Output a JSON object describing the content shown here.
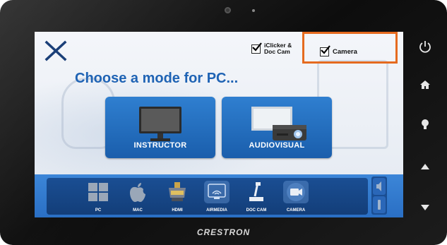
{
  "device": {
    "brand": "CRESTRON"
  },
  "screen": {
    "close_icon": "close-x-icon",
    "checkboxes": [
      {
        "label": "iClicker & Doc Cam",
        "checked": true
      },
      {
        "label": "Camera",
        "checked": true
      }
    ],
    "title": "Choose a mode for PC...",
    "modes": [
      {
        "label": "INSTRUCTOR",
        "icon": "monitor-icon"
      },
      {
        "label": "AUDIOVISUAL",
        "icon": "projector-icon"
      }
    ],
    "sources": [
      {
        "label": "PC",
        "icon": "windows-icon",
        "selected": false
      },
      {
        "label": "MAC",
        "icon": "apple-icon",
        "selected": false
      },
      {
        "label": "HDMI",
        "icon": "hdmi-icon",
        "selected": false
      },
      {
        "label": "AIRMEDIA",
        "icon": "airmedia-icon",
        "selected": true
      },
      {
        "label": "DOC CAM",
        "icon": "doc-cam-icon",
        "selected": false
      },
      {
        "label": "CAMERA",
        "icon": "video-camera-icon",
        "selected": true
      }
    ],
    "volume": {
      "up_icon": "volume-up-icon",
      "down_icon": "volume-down-icon"
    }
  },
  "side_buttons": [
    "power-icon",
    "home-icon",
    "lightbulb-icon",
    "arrow-up-icon",
    "arrow-down-icon"
  ],
  "colors": {
    "accent_blue": "#1f63b4",
    "highlight_orange": "#e56b1f"
  }
}
